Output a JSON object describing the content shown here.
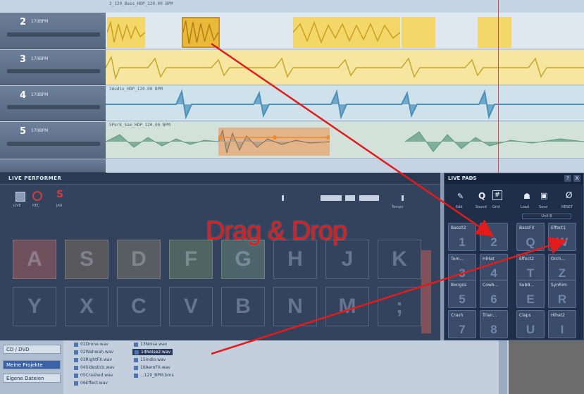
{
  "arranger": {
    "tracks": [
      {
        "number": "2",
        "name": "170BPM",
        "lane_label": "2_120_Bass_HDP_120.00 BPM"
      },
      {
        "number": "3",
        "name": "170BPM",
        "lane_label": ""
      },
      {
        "number": "4",
        "name": "170BPM",
        "lane_label": "3Audio_HDP_120.00 BPM"
      },
      {
        "number": "5",
        "name": "170BPM",
        "lane_label": "5Perk_Sax_HDP_120.00 BPM"
      }
    ],
    "colors": {
      "yellow": "#f0cf4a",
      "blue": "#6fa8c8",
      "teal": "#7fae9a",
      "orange": "#f08a2a",
      "playhead": "#e0474a"
    }
  },
  "performer": {
    "title": "LIVE PERFORMER",
    "mode_labels": [
      "LIVE",
      "REC",
      "JAU"
    ],
    "tempo_label": "Tempo",
    "keys_row1": [
      "A",
      "S",
      "D",
      "F",
      "G",
      "H",
      "J",
      "K"
    ],
    "keys_row2": [
      "Y",
      "X",
      "C",
      "V",
      "B",
      "N",
      "M",
      ";"
    ]
  },
  "pads": {
    "title": "LIVE PADS",
    "help": "?",
    "close": "X",
    "tools": [
      "Edit",
      "Sound",
      "Grid",
      "Load",
      "Save",
      "RESET"
    ],
    "unit_label": "Unit B",
    "items": [
      {
        "label": "Bass02",
        "key": "1"
      },
      {
        "label": "",
        "key": "2"
      },
      {
        "label": "BassFX",
        "key": "Q"
      },
      {
        "label": "Effect1",
        "key": "W"
      },
      {
        "label": "Tom...",
        "key": "3"
      },
      {
        "label": "HiHat",
        "key": "4"
      },
      {
        "label": "Effect2",
        "key": "T"
      },
      {
        "label": "Orch...",
        "key": "Z"
      },
      {
        "label": "Bongos",
        "key": "5"
      },
      {
        "label": "Cowb...",
        "key": "6"
      },
      {
        "label": "SubB...",
        "key": "E"
      },
      {
        "label": "SynRim",
        "key": "R"
      },
      {
        "label": "Crash",
        "key": "7"
      },
      {
        "label": "Trian...",
        "key": "8"
      },
      {
        "label": "Claps",
        "key": "U"
      },
      {
        "label": "Hihat2",
        "key": "I"
      }
    ]
  },
  "browser": {
    "nav": [
      "CD / DVD",
      "Meine Projekte",
      "Eigene Dateien"
    ],
    "files_col1": [
      "01Drone.wav",
      "02Wahwah.wav",
      "03RightFX.wav",
      "04Sidestick.wav",
      "05Crashed.wav",
      "06Effect.wav"
    ],
    "files_col2": [
      "13Noise.wav",
      "14Noise2.wav",
      "15Indio.wav",
      "16AeroFX.wav",
      "...120_BPM.bms"
    ],
    "selected_file": "14Noise2.wav"
  },
  "annotation": {
    "text": "Drag & Drop",
    "color": "#e31b1b"
  }
}
